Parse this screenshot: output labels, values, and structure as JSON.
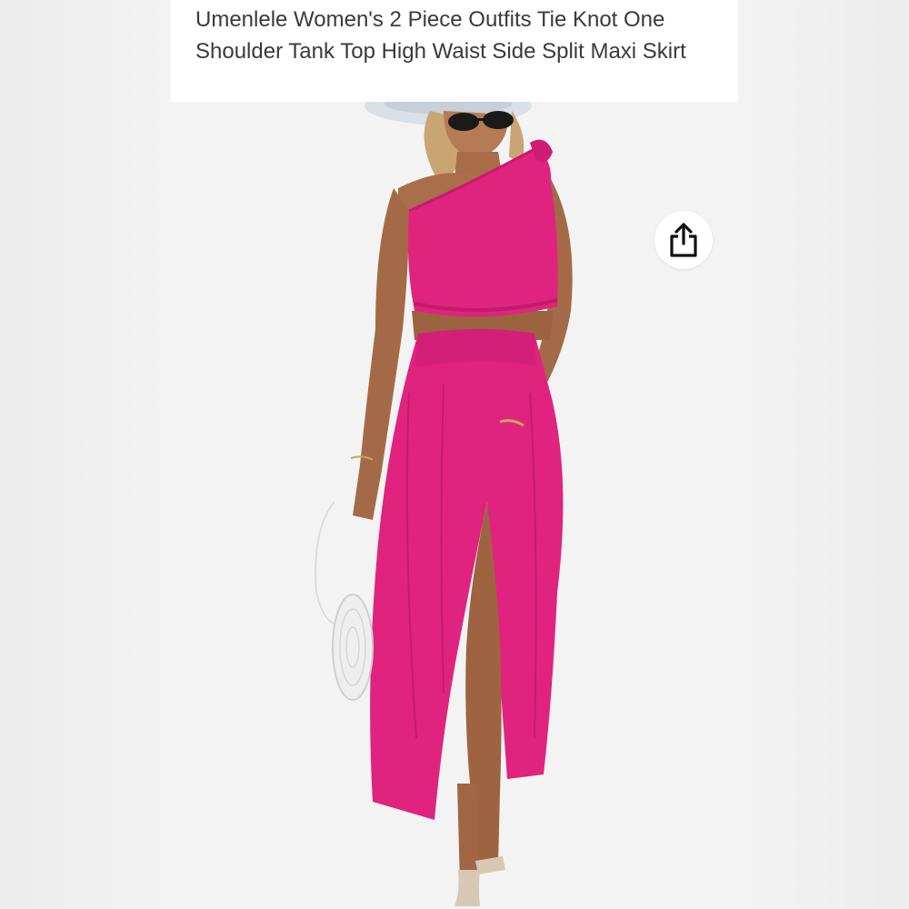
{
  "product": {
    "title": "Umenlele Women's 2 Piece Outfits Tie Knot One Shoulder Tank Top High Waist Side Split Maxi Skirt"
  },
  "image": {
    "subject": "model-wearing-pink-two-piece-outfit",
    "outfit_color": "#e0237f"
  },
  "actions": {
    "share_icon": "share-icon"
  }
}
